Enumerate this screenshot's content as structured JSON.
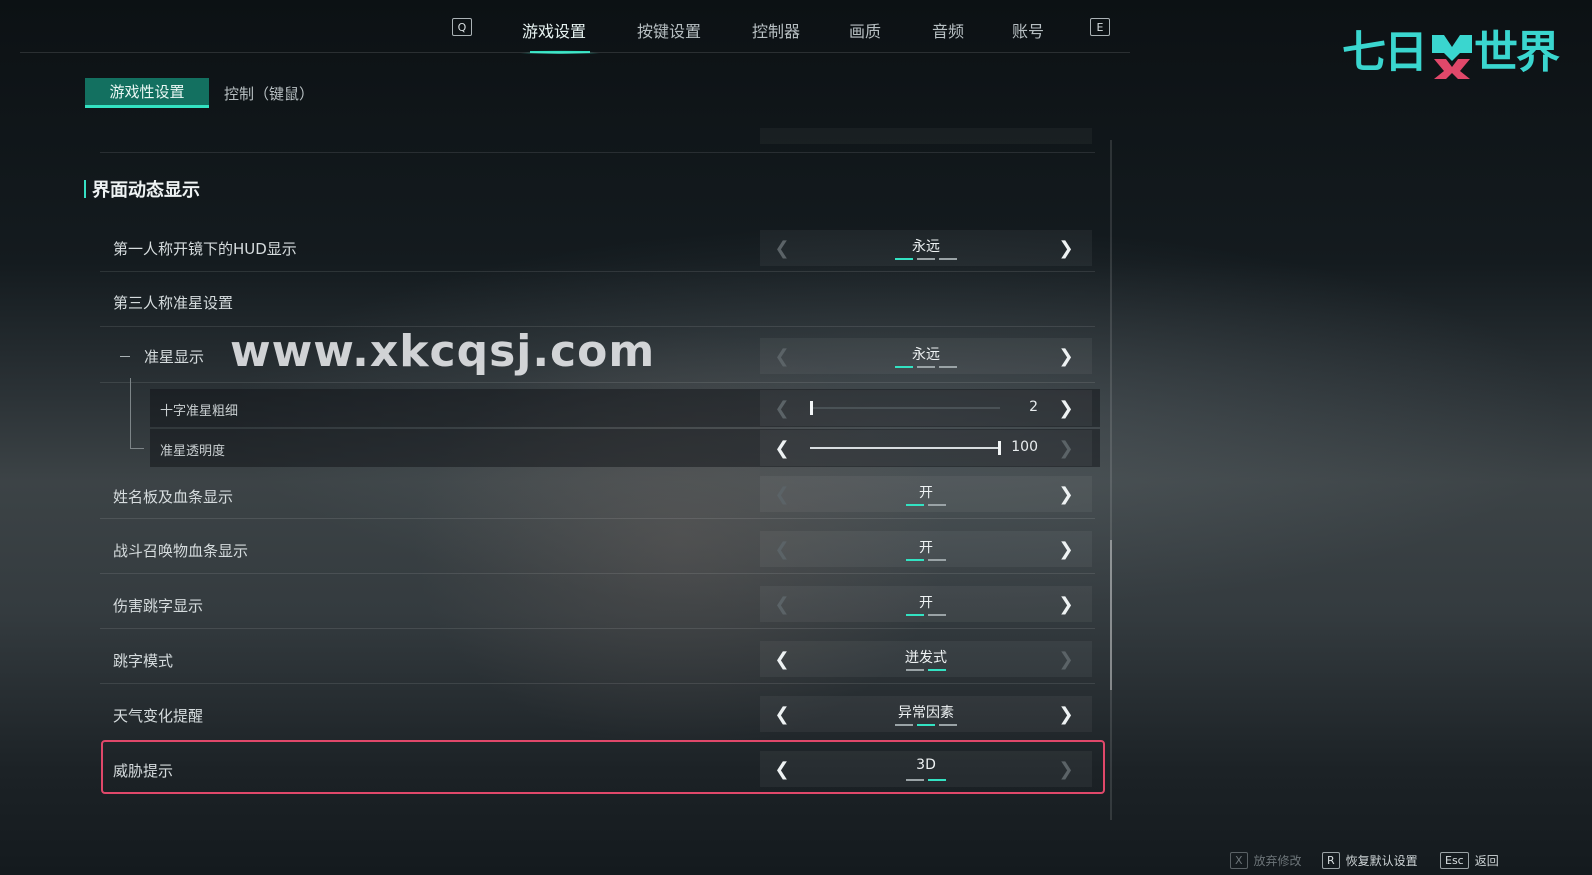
{
  "nav": {
    "key_left": "Q",
    "key_right": "E",
    "tabs": [
      {
        "label": "游戏设置",
        "active": true
      },
      {
        "label": "按键设置",
        "active": false
      },
      {
        "label": "控制器",
        "active": false
      },
      {
        "label": "画质",
        "active": false
      },
      {
        "label": "音频",
        "active": false
      },
      {
        "label": "账号",
        "active": false
      }
    ]
  },
  "logo": {
    "text": "七日世界",
    "part1": "七日",
    "part2": "世界"
  },
  "subtabs": [
    {
      "label": "游戏性设置",
      "active": true
    },
    {
      "label": "控制（键鼠）",
      "active": false
    }
  ],
  "section": {
    "title": "界面动态显示"
  },
  "rows": {
    "hud": {
      "label": "第一人称开镜下的HUD显示",
      "value": "永远",
      "options": 3,
      "index": 0
    },
    "tp_crosshair": {
      "label": "第三人称准星设置"
    },
    "crosshair_display": {
      "label": "准星显示",
      "value": "永远",
      "options": 3,
      "index": 0
    },
    "crosshair_thickness": {
      "label": "十字准星粗细",
      "value": "2",
      "level": 0.0
    },
    "crosshair_opacity": {
      "label": "准星透明度",
      "value": "100",
      "level": 1.0
    },
    "nameplate": {
      "label": "姓名板及血条显示",
      "value": "开",
      "options": 2,
      "index": 0
    },
    "summon_hp": {
      "label": "战斗召唤物血条显示",
      "value": "开",
      "options": 2,
      "index": 0
    },
    "damage_numbers": {
      "label": "伤害跳字显示",
      "value": "开",
      "options": 2,
      "index": 0
    },
    "number_mode": {
      "label": "跳字模式",
      "value": "迸发式",
      "options": 2,
      "index": 1
    },
    "weather_alert": {
      "label": "天气变化提醒",
      "value": "异常因素",
      "options": 3,
      "index": 1
    },
    "threat_hint": {
      "label": "威胁提示",
      "value": "3D",
      "options": 2,
      "index": 1
    }
  },
  "watermark": "www.xkcqsj.com",
  "footer": [
    {
      "key": "X",
      "label": "放弃修改",
      "enabled": false
    },
    {
      "key": "R",
      "label": "恢复默认设置",
      "enabled": true
    },
    {
      "key": "Esc",
      "label": "返回",
      "enabled": true
    }
  ],
  "colors": {
    "accent": "#33e2c2",
    "highlight": "#e0486a",
    "logo": "#3ad6cf",
    "logo_mark": "#e0486a"
  }
}
